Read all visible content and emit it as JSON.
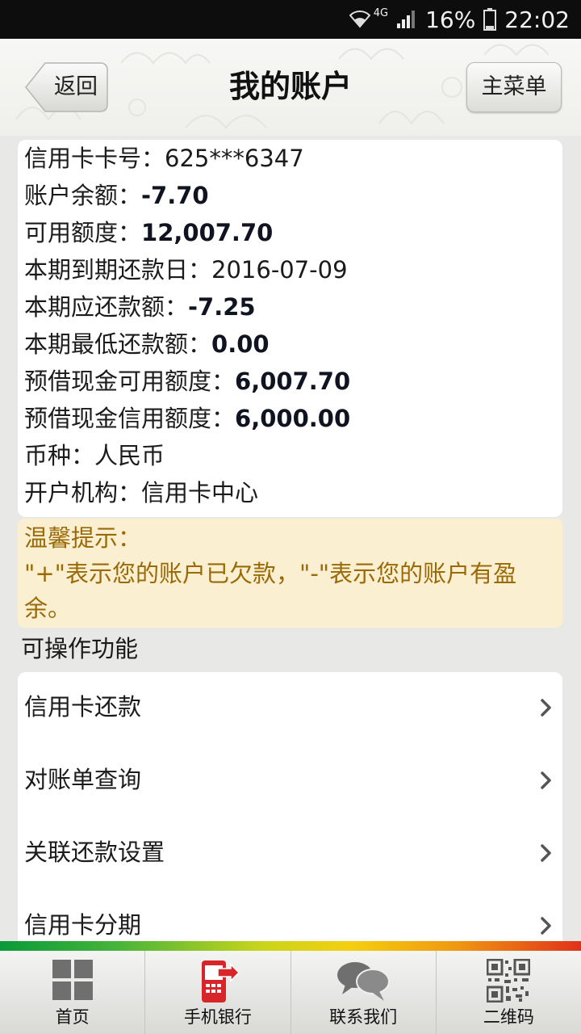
{
  "status_bar": {
    "network": "4G",
    "battery": "16%",
    "time": "22:02"
  },
  "header": {
    "back_label": "返回",
    "title": "我的账户",
    "menu_label": "主菜单"
  },
  "account_info": {
    "rows": [
      {
        "label": "信用卡卡号：",
        "value": "625***6347"
      },
      {
        "label": "账户余额：",
        "value": "-7.70"
      },
      {
        "label": "可用额度：",
        "value": "12,007.70"
      },
      {
        "label": "本期到期还款日：",
        "value": "2016-07-09"
      },
      {
        "label": "本期应还款额：",
        "value": "-7.25"
      },
      {
        "label": "本期最低还款额：",
        "value": "0.00"
      },
      {
        "label": "预借现金可用额度：",
        "value": "6,007.70"
      },
      {
        "label": "预借现金信用额度：",
        "value": "6,000.00"
      },
      {
        "label": "币种：",
        "value": "人民币"
      },
      {
        "label": "开户机构：",
        "value": "信用卡中心"
      }
    ]
  },
  "tip": {
    "title": "温馨提示：",
    "line1": "\"+\"表示您的账户已欠款，\"-\"表示您的账户有盈",
    "line2": "余。"
  },
  "functions": {
    "section_label": "可操作功能",
    "items": [
      {
        "label": "信用卡还款"
      },
      {
        "label": "对账单查询"
      },
      {
        "label": "关联还款设置"
      },
      {
        "label": "信用卡分期"
      }
    ]
  },
  "tabbar": {
    "tabs": [
      {
        "label": "首页",
        "icon": "home-grid-icon"
      },
      {
        "label": "手机银行",
        "icon": "mobile-bank-icon"
      },
      {
        "label": "联系我们",
        "icon": "chat-bubbles-icon"
      },
      {
        "label": "二维码",
        "icon": "qr-code-icon"
      }
    ]
  },
  "colors": {
    "tip_bg": "#fbefd2",
    "tip_text": "#9a6a06",
    "accent_red": "#d8252a"
  }
}
